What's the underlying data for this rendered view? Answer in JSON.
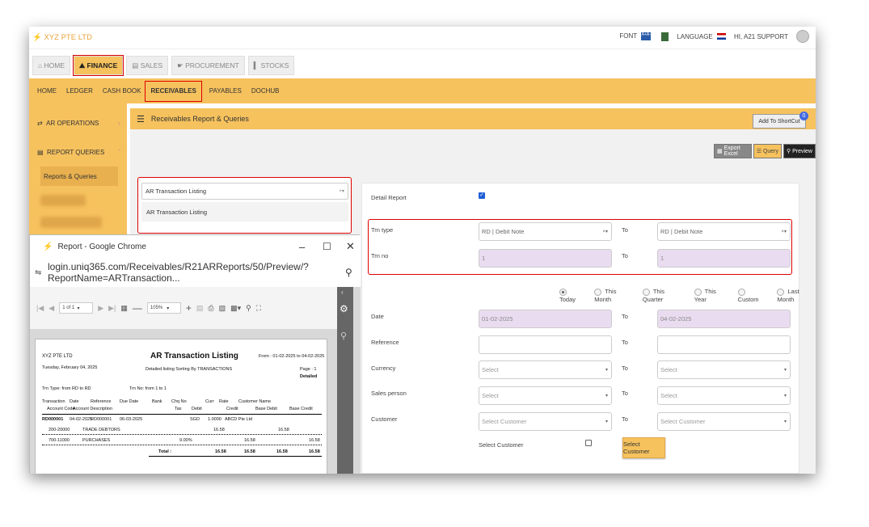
{
  "app": {
    "brand": "XYZ PTE LTD"
  },
  "top_right": {
    "font_label": "FONT",
    "font_icon": "A+A-",
    "language_label": "LANGUAGE",
    "user_label": "HI, A21 SUPPORT"
  },
  "modules": [
    "HOME",
    "FINANCE",
    "SALES",
    "PROCUREMENT",
    "STOCKS"
  ],
  "subnav": [
    "HOME",
    "LEDGER",
    "CASH BOOK",
    "RECEIVABLES",
    "PAYABLES",
    "DOCHUB"
  ],
  "sidebar": {
    "ar_operations": "AR OPERATIONS",
    "report_queries": "REPORT QUERIES",
    "reports_queries": "Reports & Queries"
  },
  "header": {
    "title": "Receivables Report & Queries",
    "shortcut": "Add To ShortCut",
    "badge": "0"
  },
  "actions": {
    "export": "Export Excel",
    "query": "Query",
    "preview": "Preview"
  },
  "report_select": {
    "value": "AR Transaction Listing",
    "option": "AR Transaction Listing"
  },
  "form": {
    "detail_report": "Detail Report",
    "trn_type": "Trn type",
    "trn_type_from": "RD | Debit Note",
    "trn_type_to": "RD | Debit Note",
    "trn_no": "Trn no",
    "trn_no_from": "1",
    "trn_no_to": "1",
    "to": "To",
    "periods": [
      "Today",
      "This Month",
      "This Quarter",
      "This Year",
      "Custom",
      "Last Month"
    ],
    "date": "Date",
    "date_from": "01-02-2025",
    "date_to": "04-02-2025",
    "reference": "Reference",
    "currency": "Currency",
    "salesperson": "Sales person",
    "customer": "Customer",
    "select": "Select",
    "select_customer": "Select Customer",
    "select_customer_label": "Select Customer",
    "select_customer_button": "Select Customer"
  },
  "chrome": {
    "title": "Report - Google Chrome",
    "url": "login.uniq365.com/Receivables/R21ARReports/50/Preview/?ReportName=ARTransaction...",
    "page": "1 of 1",
    "zoom": "105%"
  },
  "report": {
    "company": "XYZ PTE LTD",
    "date": "Tuesday, February 04, 2025",
    "title": "AR Transaction Listing",
    "subtitle": "Detailed listing Sorting By TRANSACTIONS",
    "from": "From : 01-02-2025 to 04-02-2025",
    "page": "Page : 1",
    "mode": "Detailed",
    "trntype": "Trn Type: from RD to RD",
    "trnno": "Trn No: from 1 to 1",
    "h1": [
      "Transaction",
      "Date",
      "Reference",
      "Due Date",
      "Bank",
      "Chq No",
      "Curr",
      "Rate",
      "Customer Name"
    ],
    "h2": [
      "Account Code",
      "Account Description",
      "Tax",
      "Debit",
      "Credit",
      "Base Debit",
      "Base Credit"
    ],
    "row1": [
      "RD000001",
      "04-02-2025",
      "RD000001",
      "06-03-2025",
      "SGD",
      "1.0000",
      "ABCD Pte Ltd"
    ],
    "row2": [
      "200-20000",
      "TRADE DEBTORS",
      "16.58",
      "16.58"
    ],
    "row3": [
      "700-11000",
      "PURCHASES",
      "9.00%",
      "16.58",
      "16.58"
    ],
    "total": [
      "Total :",
      "16.58",
      "16.58",
      "16.58",
      "16.58"
    ]
  }
}
